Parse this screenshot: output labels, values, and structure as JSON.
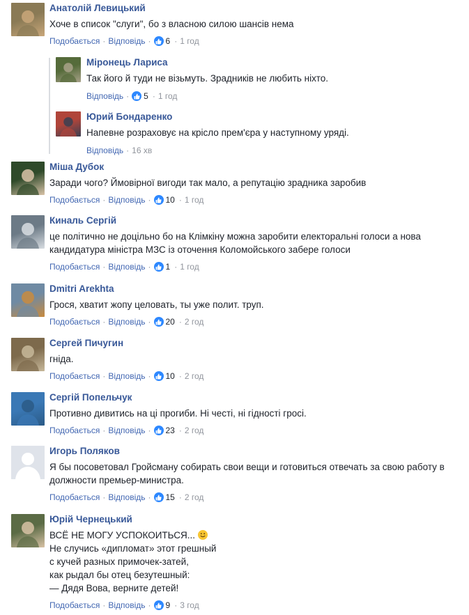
{
  "comments": [
    {
      "author": "Анатолій Левицький",
      "lines": [
        "Хоче в список \"слуги\", бо з власною силою шансів нема"
      ],
      "like_label": "Подобається",
      "reply_label": "Відповідь",
      "likes": "6",
      "time": "1 год",
      "avatar_colors": [
        "#8a7a55",
        "#c9a77a"
      ],
      "replies": [
        {
          "author": "Міронець Лариса",
          "lines": [
            "Так його й туди не візьмуть. Зрадників не любить ніхто."
          ],
          "reply_label": "Відповідь",
          "likes": "5",
          "time": "1 год",
          "avatar_colors": [
            "#556b3a",
            "#a9a28a"
          ]
        },
        {
          "author": "Юрий Бондаренко",
          "lines": [
            "Напевне розраховує на крісло прем'єра у наступному уряді."
          ],
          "reply_label": "Відповідь",
          "likes": "",
          "time": "16 хв",
          "avatar_colors": [
            "#b0453a",
            "#3a3f52"
          ]
        }
      ]
    },
    {
      "author": "Міша Дубок",
      "lines": [
        "Заради чого? Ймовірної вигоди так мало, а репутацію зрадника заробив"
      ],
      "like_label": "Подобається",
      "reply_label": "Відповідь",
      "likes": "10",
      "time": "1 год",
      "avatar_colors": [
        "#2f4a2a",
        "#d9c3a8"
      ]
    },
    {
      "author": "Киналь Сергій",
      "lines": [
        "це політично не доцільно бо на Клімкіну можна заробити електоральні голоси а нова",
        "кандидатура міністра МЗС із оточення Коломойського забере голоси"
      ],
      "like_label": "Подобається",
      "reply_label": "Відповідь",
      "likes": "1",
      "time": "1 год",
      "avatar_colors": [
        "#6c7a86",
        "#d8dde2"
      ]
    },
    {
      "author": "Dmitri Arekhta",
      "lines": [
        "Грося, хватит жопу целовать, ты уже полит. труп."
      ],
      "like_label": "Подобається",
      "reply_label": "Відповідь",
      "likes": "20",
      "time": "2 год",
      "avatar_colors": [
        "#6f8aa3",
        "#c98b3f"
      ]
    },
    {
      "author": "Сергей Пичугин",
      "lines": [
        "гніда."
      ],
      "like_label": "Подобається",
      "reply_label": "Відповідь",
      "likes": "10",
      "time": "2 год",
      "avatar_colors": [
        "#7d6a4c",
        "#c7b89a"
      ]
    },
    {
      "author": "Сергій Попельчук",
      "lines": [
        "Противно дивитись на ці прогиби. Ні честі, ні гідності гросі."
      ],
      "like_label": "Подобається",
      "reply_label": "Відповідь",
      "likes": "23",
      "time": "2 год",
      "avatar_colors": [
        "#3a78b5",
        "#2b5a86"
      ]
    },
    {
      "author": "Игорь Поляков",
      "lines": [
        "Я бы посоветовал Гройсману собирать свои вещи и готовиться отвечать за свою работу в",
        "должности премьер-министра."
      ],
      "like_label": "Подобається",
      "reply_label": "Відповідь",
      "likes": "15",
      "time": "2 год",
      "avatar_colors": [
        "#dfe3ea",
        "#ffffff"
      ]
    },
    {
      "author": "Юрій Чернецький",
      "lines": [
        "ВСЁ НЕ МОГУ УСПОКОИТЬСЯ...",
        "Не случись «дипломат» этот грешный",
        "с кучей разных примочек-затей,",
        "как рыдал бы отец безутешный:",
        "— Дядя Вова, верните детей!"
      ],
      "like_label": "Подобається",
      "reply_label": "Відповідь",
      "likes": "9",
      "time": "3 год",
      "avatar_colors": [
        "#5b6b45",
        "#d8c2a5"
      ]
    }
  ]
}
